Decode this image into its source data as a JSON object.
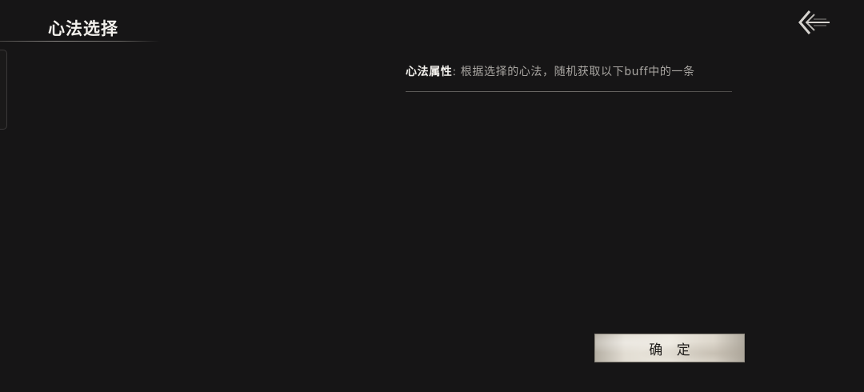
{
  "header": {
    "title": "心法选择",
    "back_icon": "back-arrow-icon"
  },
  "attribute": {
    "label": "心法属性",
    "separator": ":",
    "description": "根据选择的心法，随机获取以下buff中的一条"
  },
  "actions": {
    "confirm_label": "确 定"
  },
  "colors": {
    "background": "#161516",
    "text_primary": "#f2f0ec",
    "text_secondary": "#a9a6a2",
    "button_face": "#e2ddd3"
  }
}
